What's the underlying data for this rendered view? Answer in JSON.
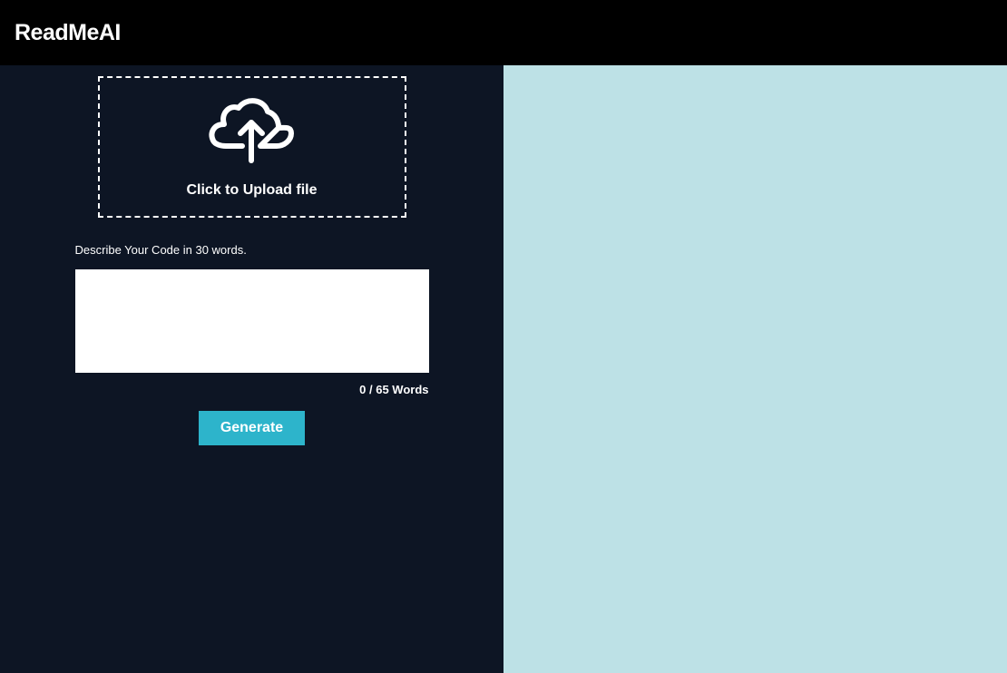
{
  "header": {
    "logo": "ReadMeAI"
  },
  "upload": {
    "prompt": "Click to Upload file"
  },
  "form": {
    "describe_label": "Describe Your Code in 30 words.",
    "describe_value": "",
    "word_count": "0 / 65 Words",
    "generate_label": "Generate"
  }
}
